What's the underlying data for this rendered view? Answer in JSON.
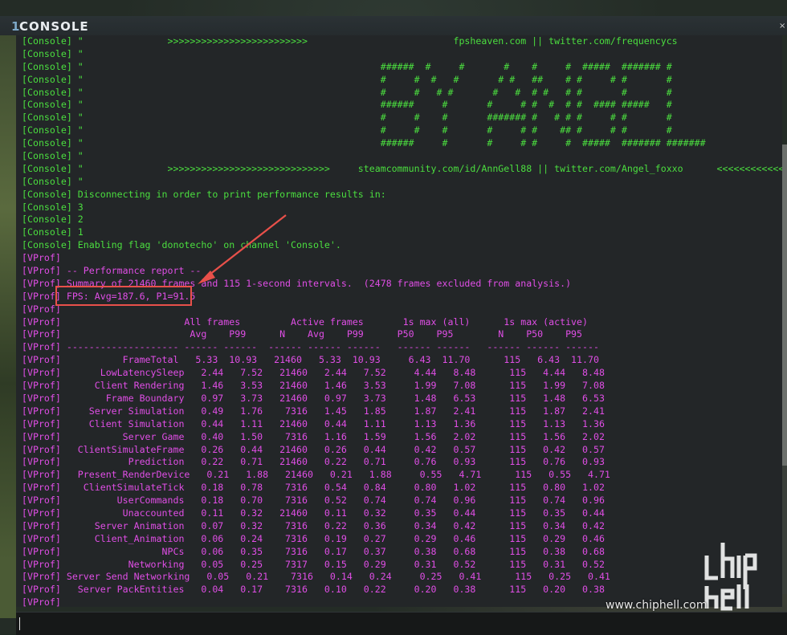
{
  "window": {
    "title_prefix": "1",
    "title": "CONSOLE",
    "close_label": "×"
  },
  "log": [
    {
      "kind": "console",
      "text": "[Console] \"               >>>>>>>>>>>>>>>>>>>>>>>>>                          fpsheaven.com || twitter.com/frequencycs                    <<<<<<<<<"
    },
    {
      "kind": "console",
      "text": "[Console] \""
    },
    {
      "kind": "console",
      "text": "[Console] \"                                                     ######  #     #       #    #     #  #####  ####### #"
    },
    {
      "kind": "console",
      "text": "[Console] \"                                                     #     #  #   #       # #   ##    # #     # #       #"
    },
    {
      "kind": "console",
      "text": "[Console] \"                                                     #     #   # #       #   #  # #   # #       #       #"
    },
    {
      "kind": "console",
      "text": "[Console] \"                                                     ######     #       #     # #  #  # #  #### #####   #"
    },
    {
      "kind": "console",
      "text": "[Console] \"                                                     #     #    #       ####### #   # # #     # #       #"
    },
    {
      "kind": "console",
      "text": "[Console] \"                                                     #     #    #       #     # #    ## #     # #       #"
    },
    {
      "kind": "console",
      "text": "[Console] \"                                                     ######     #       #     # #     #  #####  ####### #######"
    },
    {
      "kind": "console",
      "text": "[Console] \""
    },
    {
      "kind": "console",
      "text": "[Console] \"               >>>>>>>>>>>>>>>>>>>>>>>>>>>>>     steamcommunity.com/id/AnnGell88 || twitter.com/Angel_foxxo      <<<<<<<<<<<<"
    },
    {
      "kind": "console",
      "text": "[Console] \""
    },
    {
      "kind": "console",
      "text": "[Console] Disconnecting in order to print performance results in:"
    },
    {
      "kind": "console",
      "text": "[Console] 3"
    },
    {
      "kind": "console",
      "text": "[Console] 2"
    },
    {
      "kind": "console",
      "text": "[Console] 1"
    },
    {
      "kind": "console",
      "text": "[Console] Enabling flag 'donotecho' on channel 'Console'."
    },
    {
      "kind": "vprof",
      "text": "[VProf]"
    },
    {
      "kind": "vprof",
      "text": "[VProf] -- Performance report --"
    },
    {
      "kind": "vprof",
      "text": "[VProf] Summary of 21460 frames and 115 1-second intervals.  (2478 frames excluded from analysis.)"
    },
    {
      "kind": "vprof",
      "text": "[VProf] FPS: Avg=187.6, P1=91.5"
    },
    {
      "kind": "vprof",
      "text": "[VProf]"
    },
    {
      "kind": "vprof",
      "text": "[VProf]                      All frames         Active frames       1s max (all)      1s max (active)"
    },
    {
      "kind": "vprof",
      "text": "[VProf]                       Avg    P99      N    Avg    P99      P50    P95        N    P50    P95"
    },
    {
      "kind": "vprof",
      "text": "[VProf] -------------------- ------ ------  ------ ------ ------   ------ ------   ------ ------ ------"
    },
    {
      "kind": "vprof",
      "text": "[VProf]           FrameTotal   5.33  10.93   21460   5.33  10.93     6.43  11.70      115   6.43  11.70"
    },
    {
      "kind": "vprof",
      "text": "[VProf]       LowLatencySleep   2.44   7.52   21460   2.44   7.52     4.44   8.48      115   4.44   8.48"
    },
    {
      "kind": "vprof",
      "text": "[VProf]      Client Rendering   1.46   3.53   21460   1.46   3.53     1.99   7.08      115   1.99   7.08"
    },
    {
      "kind": "vprof",
      "text": "[VProf]        Frame Boundary   0.97   3.73   21460   0.97   3.73     1.48   6.53      115   1.48   6.53"
    },
    {
      "kind": "vprof",
      "text": "[VProf]     Server Simulation   0.49   1.76    7316   1.45   1.85     1.87   2.41      115   1.87   2.41"
    },
    {
      "kind": "vprof",
      "text": "[VProf]     Client Simulation   0.44   1.11   21460   0.44   1.11     1.13   1.36      115   1.13   1.36"
    },
    {
      "kind": "vprof",
      "text": "[VProf]           Server Game   0.40   1.50    7316   1.16   1.59     1.56   2.02      115   1.56   2.02"
    },
    {
      "kind": "vprof",
      "text": "[VProf]   ClientSimulateFrame   0.26   0.44   21460   0.26   0.44     0.42   0.57      115   0.42   0.57"
    },
    {
      "kind": "vprof",
      "text": "[VProf]            Prediction   0.22   0.71   21460   0.22   0.71     0.76   0.93      115   0.76   0.93"
    },
    {
      "kind": "vprof",
      "text": "[VProf]   Present_RenderDevice   0.21   1.88   21460   0.21   1.88     0.55   4.71      115   0.55   4.71"
    },
    {
      "kind": "vprof",
      "text": "[VProf]    ClientSimulateTick   0.18   0.78    7316   0.54   0.84     0.80   1.02      115   0.80   1.02"
    },
    {
      "kind": "vprof",
      "text": "[VProf]          UserCommands   0.18   0.70    7316   0.52   0.74     0.74   0.96      115   0.74   0.96"
    },
    {
      "kind": "vprof",
      "text": "[VProf]           Unaccounted   0.11   0.32   21460   0.11   0.32     0.35   0.44      115   0.35   0.44"
    },
    {
      "kind": "vprof",
      "text": "[VProf]      Server Animation   0.07   0.32    7316   0.22   0.36     0.34   0.42      115   0.34   0.42"
    },
    {
      "kind": "vprof",
      "text": "[VProf]      Client_Animation   0.06   0.24    7316   0.19   0.27     0.29   0.46      115   0.29   0.46"
    },
    {
      "kind": "vprof",
      "text": "[VProf]                  NPCs   0.06   0.35    7316   0.17   0.37     0.38   0.68      115   0.38   0.68"
    },
    {
      "kind": "vprof",
      "text": "[VProf]            Networking   0.05   0.25    7317   0.15   0.29     0.31   0.52      115   0.31   0.52"
    },
    {
      "kind": "vprof",
      "text": "[VProf] Server Send Networking   0.05   0.21    7316   0.14   0.24     0.25   0.41      115   0.25   0.41"
    },
    {
      "kind": "vprof",
      "text": "[VProf]   Server PackEntities   0.04   0.17    7316   0.10   0.22     0.20   0.38      115   0.20   0.38"
    },
    {
      "kind": "vprof",
      "text": "[VProf]"
    }
  ],
  "input": {
    "value": ""
  },
  "watermark": {
    "url": "www.chiphell.com",
    "logo_text": "chiphell"
  },
  "colors": {
    "console_text": "#4bde3f",
    "vprof_text": "#e04ee6",
    "highlight": "#e8504a"
  }
}
